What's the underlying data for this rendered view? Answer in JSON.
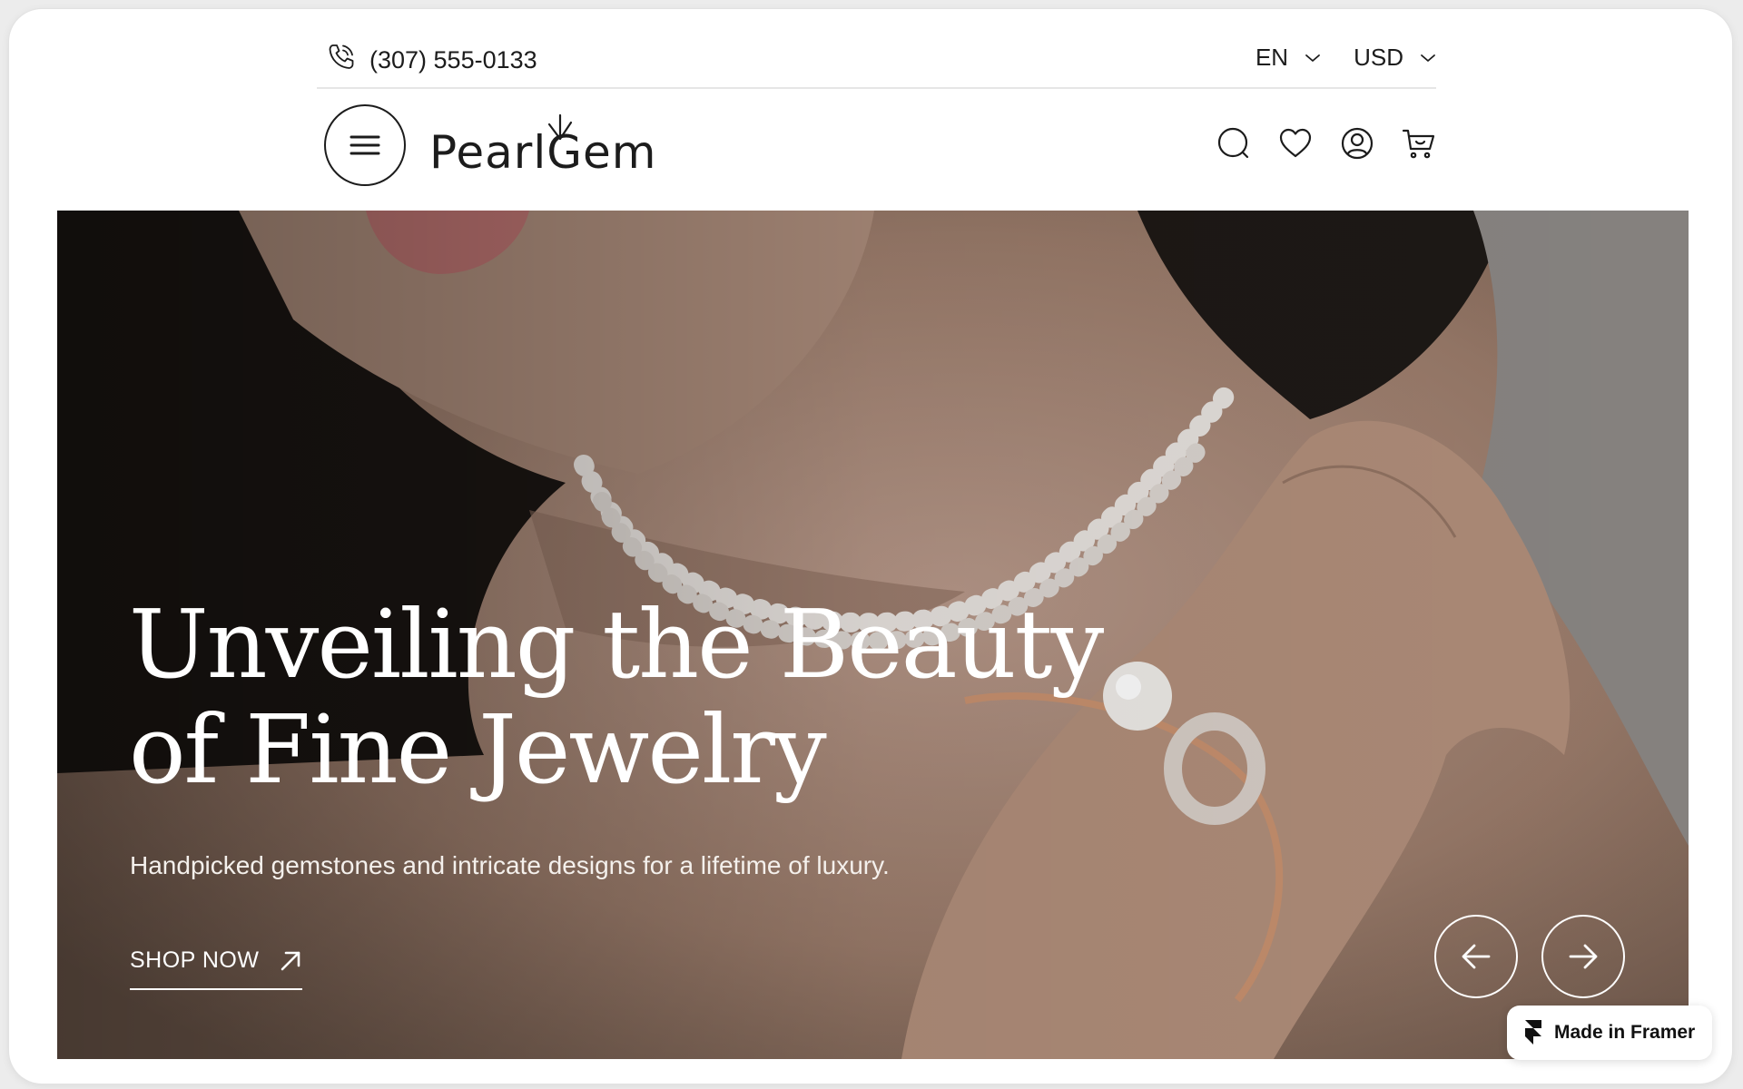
{
  "topbar": {
    "phone": "(307) 555-0133",
    "phone_icon": "phone-icon",
    "language": "EN",
    "currency": "USD"
  },
  "nav": {
    "menu_icon": "hamburger-menu-icon",
    "logo_text": "PearlGem",
    "icons": [
      "search-icon",
      "heart-icon",
      "user-icon",
      "cart-icon"
    ]
  },
  "hero": {
    "title_line1": "Unveiling the Beauty",
    "title_line2": "of Fine Jewelry",
    "subtitle": "Handpicked gemstones and intricate designs for a lifetime of luxury.",
    "cta_label": "SHOP NOW",
    "prev_icon": "arrow-left-icon",
    "next_icon": "arrow-right-icon"
  },
  "badge": {
    "label": "Made in Framer"
  },
  "colors": {
    "text": "#1c1c1c",
    "hero_text": "#ffffff",
    "divider": "#e6e6e6"
  }
}
